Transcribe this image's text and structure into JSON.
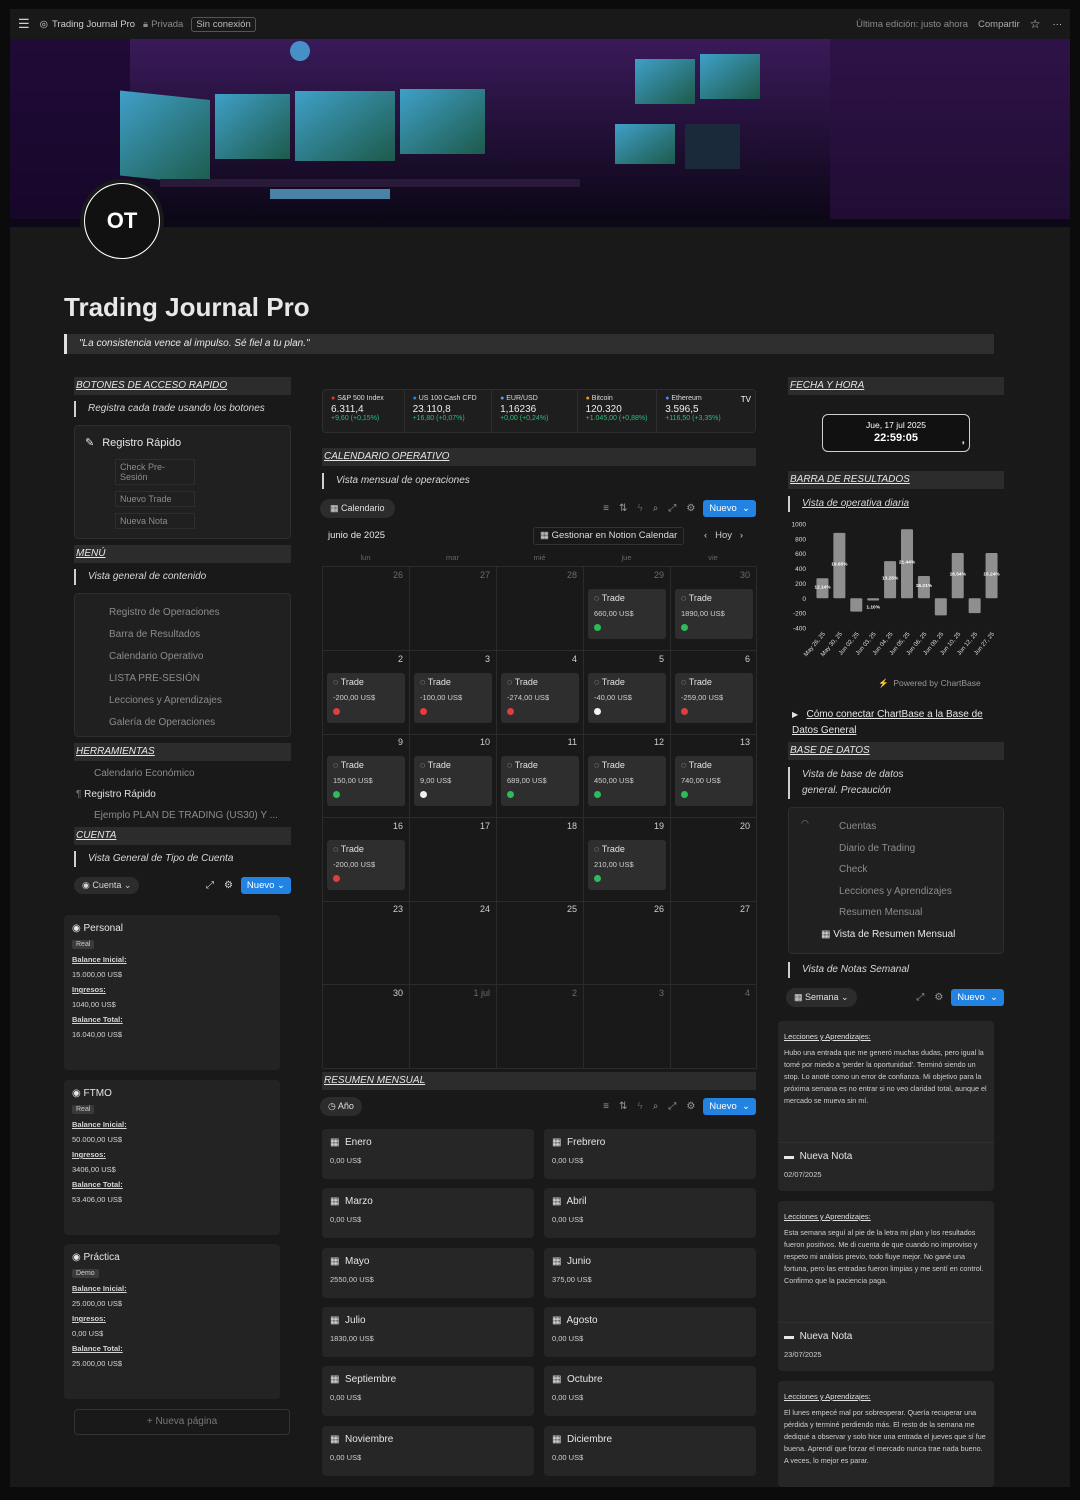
{
  "topbar": {
    "title": "Trading Journal Pro",
    "privacy": "Privada",
    "offline": "Sin conexión",
    "last_edit": "Última edición: justo ahora",
    "share": "Compartir",
    "more": "···"
  },
  "page": {
    "title": "Trading Journal Pro",
    "quote": "\"La consistencia vence al impulso. Sé fiel a tu plan.\"",
    "avatar_text": "OT"
  },
  "left": {
    "quick_access": {
      "heading": "BOTONES DE ACCESO RAPIDO",
      "callout": "Registra cada trade usando los botones",
      "box_title": "Registro Rápido",
      "buttons": [
        "Check Pre-Sesión",
        "Nuevo Trade",
        "Nueva Nota"
      ]
    },
    "menu": {
      "heading": "MENÚ",
      "callout": "Vista general de contenido",
      "items": [
        "Registro de Operaciones",
        "Barra de Resultados",
        "Calendario Operativo",
        "LISTA PRE-SESIÓN",
        "Lecciones y Aprendizajes",
        "Galería de Operaciones"
      ]
    },
    "tools": {
      "heading": "HERRAMIENTAS",
      "items": [
        "Calendario Económico",
        "Registro Rápido",
        "Ejemplo PLAN DE TRADING (US30) Y ..."
      ]
    },
    "account": {
      "heading": "CUENTA",
      "callout": "Vista General de Tipo de Cuenta",
      "view_label": "Cuenta",
      "new_label": "Nuevo",
      "labels": {
        "initial": "Balance Inicial:",
        "income": "Ingresos:",
        "total": "Balance Total:"
      },
      "cards": [
        {
          "name": "Personal",
          "tag": "Real",
          "initial": "15.000,00 US$",
          "income": "1040,00 US$",
          "total": "16.040,00 US$"
        },
        {
          "name": "FTMO",
          "tag": "Real",
          "initial": "50.000,00 US$",
          "income": "3406,00 US$",
          "total": "53.406,00 US$"
        },
        {
          "name": "Práctica",
          "tag": "Demo",
          "initial": "25.000,00 US$",
          "income": "0,00 US$",
          "total": "25.000,00 US$"
        }
      ],
      "new_page": "+ Nueva página"
    }
  },
  "ticker": [
    {
      "name": "S&P 500 Index",
      "price": "6.311,4",
      "change": "+9,60 (+0,15%)",
      "color": "#e53935"
    },
    {
      "name": "US 100 Cash CFD",
      "price": "23.110,8",
      "change": "+16,80 (+0,07%)",
      "color": "#1e88e5"
    },
    {
      "name": "EUR/USD",
      "price": "1,16236",
      "change": "+0,00 (+0,24%)",
      "color": "#42a5f5"
    },
    {
      "name": "Bitcoin",
      "price": "120.320",
      "change": "+1.045,00 (+0,88%)",
      "color": "#f7931a"
    },
    {
      "name": "Ethereum",
      "price": "3.596,5",
      "change": "+116,50 (+3,35%)",
      "color": "#627eea"
    }
  ],
  "calendar": {
    "heading": "CALENDARIO OPERATIVO",
    "callout": "Vista mensual de operaciones",
    "view_label": "Calendario",
    "new_label": "Nuevo",
    "month": "junio de 2025",
    "manage": "Gestionar en Notion Calendar",
    "today": "Hoy",
    "weekdays": [
      "lun",
      "mar",
      "mié",
      "jue",
      "vie"
    ],
    "weeks": [
      [
        {
          "d": "26",
          "dim": true
        },
        {
          "d": "27",
          "dim": true
        },
        {
          "d": "28",
          "dim": true
        },
        {
          "d": "29",
          "dim": true,
          "trade": "660,00 US$",
          "c": "g"
        },
        {
          "d": "30",
          "dim": true,
          "trade": "1890,00 US$",
          "c": "g"
        }
      ],
      [
        {
          "d": "2",
          "trade": "-200,00 US$",
          "c": "r"
        },
        {
          "d": "3",
          "trade": "-100,00 US$",
          "c": "r"
        },
        {
          "d": "4",
          "trade": "-274,00 US$",
          "c": "r"
        },
        {
          "d": "5",
          "trade": "-40,00 US$",
          "c": "w"
        },
        {
          "d": "6",
          "trade": "-259,00 US$",
          "c": "r"
        }
      ],
      [
        {
          "d": "9",
          "trade": "150,00 US$",
          "c": "g"
        },
        {
          "d": "10",
          "trade": "9,00 US$",
          "c": "w"
        },
        {
          "d": "11",
          "trade": "689,00 US$",
          "c": "g"
        },
        {
          "d": "12",
          "trade": "450,00 US$",
          "c": "g"
        },
        {
          "d": "13",
          "trade": "740,00 US$",
          "c": "g"
        }
      ],
      [
        {
          "d": "16",
          "trade": "-200,00 US$",
          "c": "r"
        },
        {
          "d": "17"
        },
        {
          "d": "18"
        },
        {
          "d": "19",
          "trade": "210,00 US$",
          "c": "g"
        },
        {
          "d": "20"
        }
      ],
      [
        {
          "d": "23"
        },
        {
          "d": "24"
        },
        {
          "d": "25"
        },
        {
          "d": "26"
        },
        {
          "d": "27"
        }
      ],
      [
        {
          "d": "30"
        },
        {
          "d": "1 jul",
          "dim": true
        },
        {
          "d": "2",
          "dim": true
        },
        {
          "d": "3",
          "dim": true
        },
        {
          "d": "4",
          "dim": true
        }
      ]
    ],
    "trade_label": "Trade"
  },
  "monthly": {
    "heading": "RESUMEN MENSUAL",
    "view_label": "Año",
    "new_label": "Nuevo",
    "months": [
      {
        "n": "Enero",
        "v": "0,00 US$"
      },
      {
        "n": "Frebrero",
        "v": "0,00 US$"
      },
      {
        "n": "Marzo",
        "v": "0,00 US$"
      },
      {
        "n": "Abril",
        "v": "0,00 US$"
      },
      {
        "n": "Mayo",
        "v": "2550,00 US$"
      },
      {
        "n": "Junio",
        "v": "375,00 US$"
      },
      {
        "n": "Julio",
        "v": "1830,00 US$"
      },
      {
        "n": "Agosto",
        "v": "0,00 US$"
      },
      {
        "n": "Septiembre",
        "v": "0,00 US$"
      },
      {
        "n": "Octubre",
        "v": "0,00 US$"
      },
      {
        "n": "Noviembre",
        "v": "0,00 US$"
      },
      {
        "n": "Diciembre",
        "v": "0,00 US$"
      }
    ]
  },
  "right": {
    "datetime": {
      "heading": "FECHA Y HORA",
      "date": "Jue, 17 jul 2025",
      "time": "22:59:05"
    },
    "results": {
      "heading": "BARRA DE RESULTADOS",
      "callout": "Vista de operativa diaria",
      "powered": "Powered by ChartBase",
      "toggle": "Cómo conectar ChartBase a la Base de Datos General"
    },
    "database": {
      "heading": "BASE DE DATOS",
      "callout": "Vista de base de datos general. Precaución",
      "items": [
        "Cuentas",
        "Diario de Trading",
        "Check",
        "Lecciones y Aprendizajes",
        "Resumen Mensual",
        "Vista de Resumen Mensual"
      ]
    },
    "notes": {
      "callout": "Vista de Notas Semanal",
      "view_label": "Semana",
      "new_label": "Nuevo",
      "cards": [
        {
          "hd": "Lecciones y Aprendizajes:",
          "body": "Hubo una entrada que me generó muchas dudas, pero igual la tomé por miedo a 'perder la oportunidad'. Terminó siendo un stop. Lo anoté como un error de confianza. Mi objetivo para la próxima semana es no entrar si no veo claridad total, aunque el mercado se mueva sin mí.",
          "title": "Nueva Nota",
          "date": "02/07/2025"
        },
        {
          "hd": "Lecciones y Aprendizajes:",
          "body": "Esta semana seguí al pie de la letra mi plan y los resultados fueron positivos. Me di cuenta de que cuando no improviso y respeto mi análisis previo, todo fluye mejor. No gané una fortuna, pero las entradas fueron limpias y me sentí en control. Confirmo que la paciencia paga.",
          "title": "Nueva Nota",
          "date": "23/07/2025"
        },
        {
          "hd": "Lecciones y Aprendizajes:",
          "body": "El lunes empecé mal por sobreoperar. Quería recuperar una pérdida y terminé perdiendo más. El resto de la semana me dediqué a observar y solo hice una entrada el jueves que sí fue buena. Aprendí que forzar el mercado nunca trae nada bueno. A veces, lo mejor es parar.",
          "title": "",
          "date": ""
        }
      ]
    }
  },
  "chart_data": {
    "type": "bar",
    "categories": [
      "May 26, 25",
      "May 30, 25",
      "Jun 02, 25",
      "Jun 03, 25",
      "Jun 04, 25",
      "Jun 05, 25",
      "Jun 06, 25",
      "Jun 09, 25",
      "Jun 10, 25",
      "Jun 12, 25",
      "Jun 27, 25"
    ],
    "values": [
      270,
      880,
      -180,
      -30,
      500,
      930,
      300,
      -230,
      610,
      -200,
      610
    ],
    "labels": [
      "12.14%",
      "19.65%",
      "",
      "1.10%",
      "13.25%",
      "21.44%",
      "15.21%",
      "",
      "16.54%",
      "",
      "15.24%"
    ],
    "ylim": [
      -400,
      1000
    ],
    "yticks": [
      1000,
      800,
      600,
      400,
      200,
      0,
      -200,
      -400
    ]
  }
}
